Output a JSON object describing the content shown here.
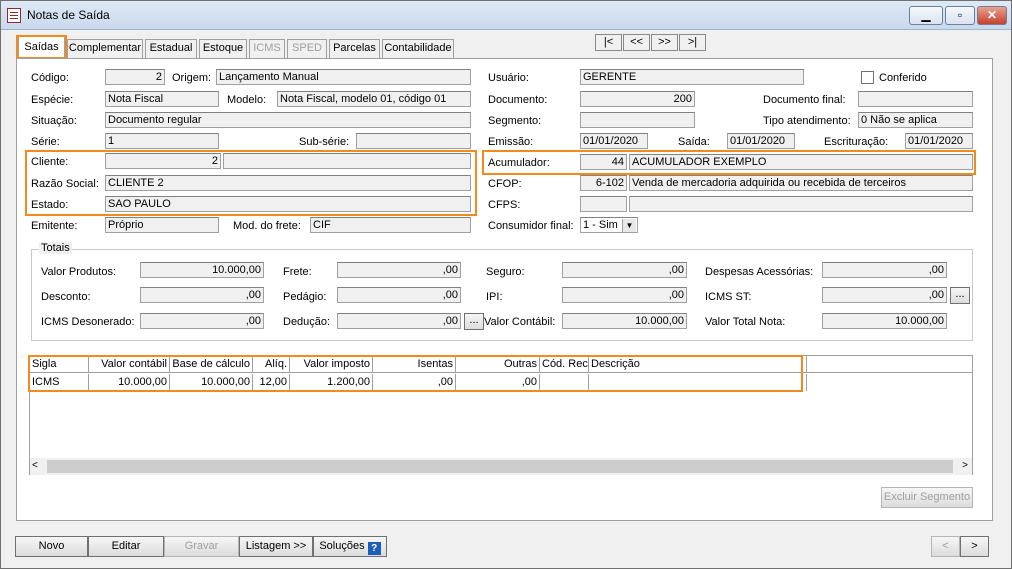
{
  "window": {
    "title": "Notas de Saída",
    "min_icon": "minimize-icon",
    "max_icon": "maximize-icon",
    "close_icon": "close-icon"
  },
  "tabs": [
    {
      "label": "Saídas",
      "enabled": true,
      "active": true
    },
    {
      "label": "Complementar",
      "enabled": true
    },
    {
      "label": "Estadual",
      "enabled": true
    },
    {
      "label": "Estoque",
      "enabled": true
    },
    {
      "label": "ICMS",
      "enabled": false
    },
    {
      "label": "SPED",
      "enabled": false
    },
    {
      "label": "Parcelas",
      "enabled": true
    },
    {
      "label": "Contabilidade",
      "enabled": true
    }
  ],
  "nav": {
    "first": "|<",
    "prev": "<<",
    "next": ">>",
    "last": ">|"
  },
  "form": {
    "codigo_label": "Código:",
    "codigo": "2",
    "origem_label": "Origem:",
    "origem": "Lançamento Manual",
    "especie_label": "Espécie:",
    "especie": "Nota Fiscal",
    "modelo_label": "Modelo:",
    "modelo": "Nota Fiscal, modelo 01, código 01",
    "situacao_label": "Situação:",
    "situacao": "Documento regular",
    "serie_label": "Série:",
    "serie": "1",
    "subserie_label": "Sub-série:",
    "subserie": "",
    "cliente_label": "Cliente:",
    "cliente": "2",
    "razao_label": "Razão Social:",
    "razao": "CLIENTE 2",
    "estado_label": "Estado:",
    "estado": "SAO PAULO",
    "emitente_label": "Emitente:",
    "emitente": "Próprio",
    "frete_label": "Mod. do frete:",
    "frete": "CIF",
    "usuario_label": "Usuário:",
    "usuario": "GERENTE",
    "conferido_label": "Conferido",
    "documento_label": "Documento:",
    "documento": "200",
    "documento_final_label": "Documento final:",
    "documento_final": "",
    "segmento_label": "Segmento:",
    "segmento": "",
    "tipo_atendimento_label": "Tipo atendimento:",
    "tipo_atendimento": "0 Não se aplica",
    "emissao_label": "Emissão:",
    "emissao": "01/01/2020",
    "saida_label": "Saída:",
    "saida": "01/01/2020",
    "escrituracao_label": "Escrituração:",
    "escrituracao": "01/01/2020",
    "acumulador_label": "Acumulador:",
    "acumulador_code": "44",
    "acumulador_desc": "ACUMULADOR EXEMPLO",
    "cfop_label": "CFOP:",
    "cfop_code": "6-102",
    "cfop_desc": "Venda de mercadoria adquirida ou recebida de terceiros",
    "cfps_label": "CFPS:",
    "cfps_code": "",
    "cfps_desc": "",
    "consumidor_label": "Consumidor final:",
    "consumidor": "1 - Sim"
  },
  "totais": {
    "title": "Totais",
    "valor_produtos_label": "Valor Produtos:",
    "valor_produtos": "10.000,00",
    "frete_label": "Frete:",
    "frete": ",00",
    "seguro_label": "Seguro:",
    "seguro": ",00",
    "despesas_label": "Despesas Acessórias:",
    "despesas": ",00",
    "desconto_label": "Desconto:",
    "desconto": ",00",
    "pedagio_label": "Pedágio:",
    "pedagio": ",00",
    "ipi_label": "IPI:",
    "ipi": ",00",
    "icms_st_label": "ICMS ST:",
    "icms_st": ",00",
    "icms_deson_label": "ICMS Desonerado:",
    "icms_deson": ",00",
    "deducao_label": "Dedução:",
    "deducao": ",00",
    "valor_contabil_label": "Valor Contábil:",
    "valor_contabil": "10.000,00",
    "valor_total_label": "Valor Total Nota:",
    "valor_total": "10.000,00",
    "ellipsis": "..."
  },
  "grid": {
    "headers": [
      "Sigla",
      "Valor contábil",
      "Base de cálculo",
      "Alíq.",
      "Valor imposto",
      "Isentas",
      "Outras",
      "Cód. Rec.",
      "Descrição"
    ],
    "rows": [
      [
        "ICMS",
        "10.000,00",
        "10.000,00",
        "12,00",
        "1.200,00",
        ",00",
        ",00",
        "",
        ""
      ]
    ]
  },
  "buttons": {
    "excluir_segmento": "Excluir Segmento",
    "novo": "Novo",
    "editar": "Editar",
    "gravar": "Gravar",
    "listagem": "Listagem >>",
    "solucoes": "Soluções",
    "help": "?",
    "prev": "<",
    "next": ">"
  },
  "colors": {
    "highlight": "#f28a1e"
  }
}
